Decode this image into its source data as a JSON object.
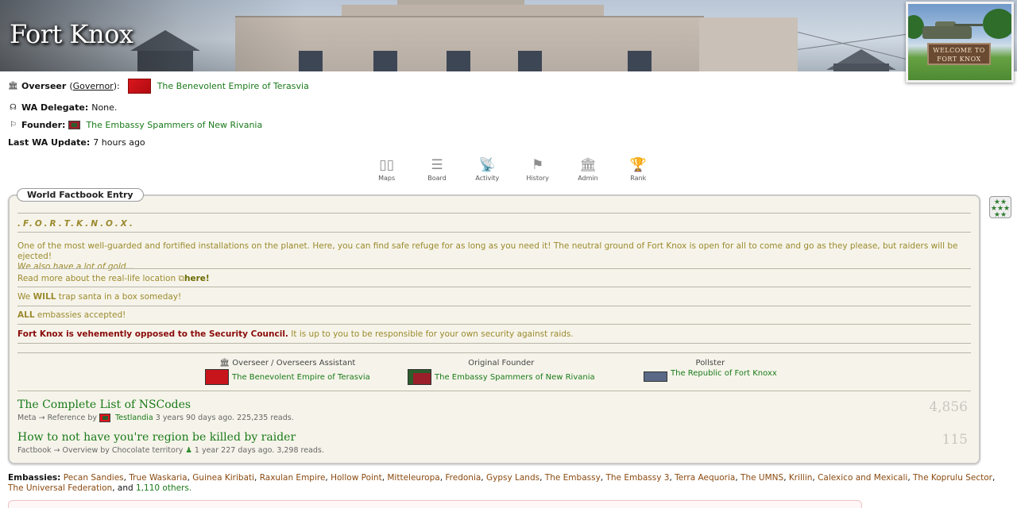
{
  "region": {
    "title": "Fort Knox",
    "flag_sign": "WELCOME TO\nFORT KNOX"
  },
  "info": {
    "overseer_label": "Overseer",
    "governor_label": "Governor",
    "overseer_nation": "The Benevolent Empire of Terasvia",
    "wa_delegate_label": "WA Delegate:",
    "wa_delegate_value": "None.",
    "founder_label": "Founder:",
    "founder_nation": "The Embassy Spammers of New Rivania",
    "last_update_label": "Last WA Update:",
    "last_update_value": "7 hours ago"
  },
  "nav": [
    {
      "label": "Maps",
      "icon": "map-icon"
    },
    {
      "label": "Board",
      "icon": "board-icon"
    },
    {
      "label": "Activity",
      "icon": "activity-icon"
    },
    {
      "label": "History",
      "icon": "history-flag-icon"
    },
    {
      "label": "Admin",
      "icon": "admin-building-icon"
    },
    {
      "label": "Rank",
      "icon": "trophy-icon"
    }
  ],
  "factbook": {
    "tab_label": "World Factbook Entry",
    "heading": ".F.O.R.T.K.N.O.X.",
    "para1": "One of the most well-guarded and fortified installations on the planet. Here, you can find safe refuge for as long as you need it! The neutral ground of Fort Knox is open for all to come and go as they please, but raiders will be ejected!",
    "para1_italic": "We also have a lot of gold...",
    "read_more": "Read more about the real-life location",
    "read_more_link": "here!",
    "santa_pre": "We",
    "santa_bold": "WILL",
    "santa_post": "trap santa in a box someday!",
    "embassy_bold": "ALL",
    "embassy_post": "embassies accepted!",
    "security_bold": "Fort Knox is vehemently opposed to the Security Council.",
    "security_post": "It is up to you to be responsible for your own security against raids."
  },
  "officers": [
    {
      "role": "Overseer / Overseers Assistant",
      "nation": "The Benevolent Empire of Terasvia",
      "flag_color": "#c8141b"
    },
    {
      "role": "Original Founder",
      "nation": "The Embassy Spammers of New Rivania",
      "flag_color": "#9b1f2a"
    },
    {
      "role": "Pollster",
      "nation": "The Republic of Fort Knoxx",
      "flag_color": "#5a6a86"
    }
  ],
  "dispatches": [
    {
      "title": "The Complete List of NSCodes",
      "category": "Meta",
      "subcategory": "Reference",
      "by": "by",
      "author": "Testlandia",
      "age": "3 years 90 days ago. 225,235 reads.",
      "count": "4,856"
    },
    {
      "title": "How to not have you're region be killed by raider",
      "category": "Factbook",
      "subcategory": "Overview",
      "by": "by",
      "author": "Chocolate territory",
      "age": "1 year 227 days ago. 3,298 reads.",
      "count": "115"
    }
  ],
  "embassies": {
    "label": "Embassies:",
    "list": [
      "Pecan Sandies",
      "True Waskaria",
      "Guinea Kiribati",
      "Raxulan Empire",
      "Hollow Point",
      "Mitteleuropa",
      "Fredonia",
      "Gypsy Lands",
      "The Embassy",
      "The Embassy 3",
      "Terra Aequoria",
      "The UMNS",
      "Krillin",
      "Calexico and Mexicali",
      "The Koprulu Sector",
      "The Universal Federation"
    ],
    "and": "and",
    "others": "1,110 others."
  },
  "colors": {
    "link_green": "#1a7a1a",
    "factbook_text": "#9b8a2e",
    "security_red": "#8a0b0b",
    "embassy_link": "#8a4a10"
  }
}
